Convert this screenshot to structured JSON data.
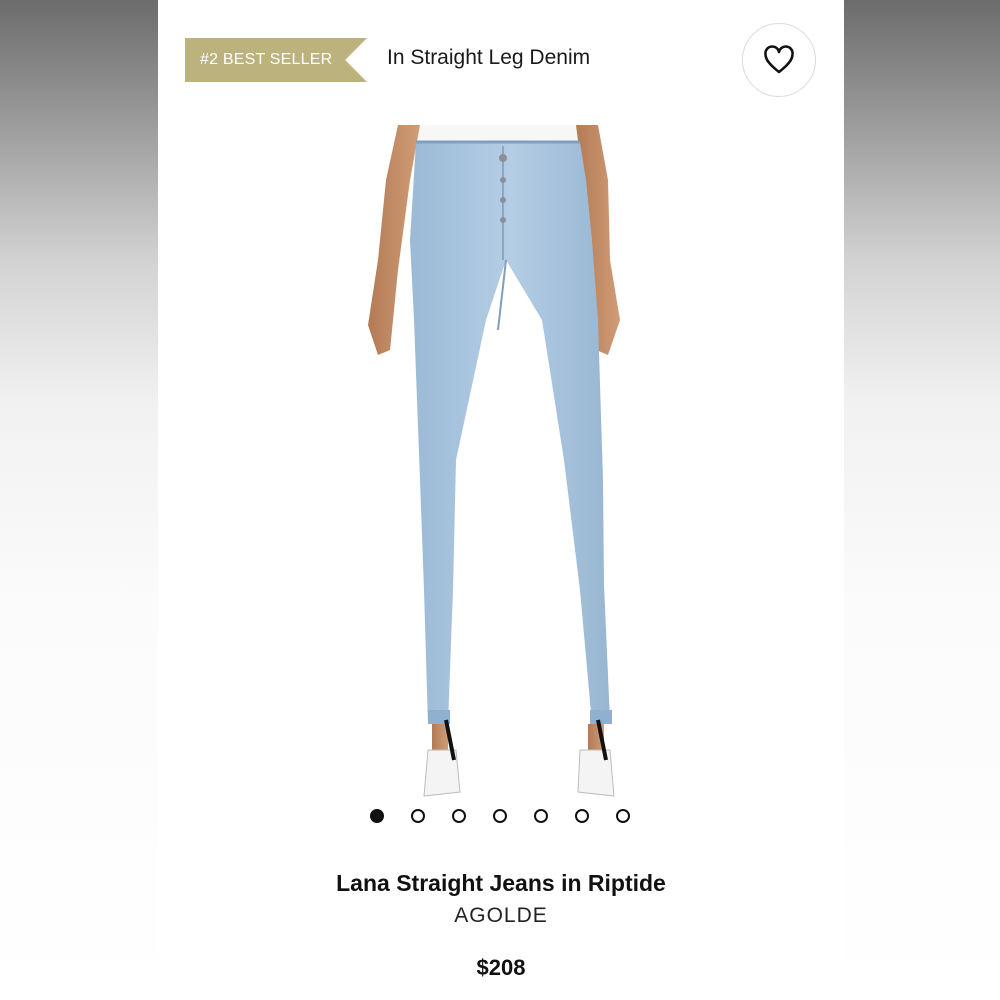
{
  "badge": {
    "label": "#2 BEST SELLER"
  },
  "category": {
    "label": "In Straight Leg Denim"
  },
  "favorite": {
    "icon": "heart-icon"
  },
  "product": {
    "title": "Lana Straight Jeans in Riptide",
    "brand": "AGOLDE",
    "price": "$208"
  },
  "carousel": {
    "count": 7,
    "active_index": 1
  },
  "colors": {
    "badge": "#bcb27d",
    "denim": "#a9c5df",
    "text": "#111111"
  }
}
